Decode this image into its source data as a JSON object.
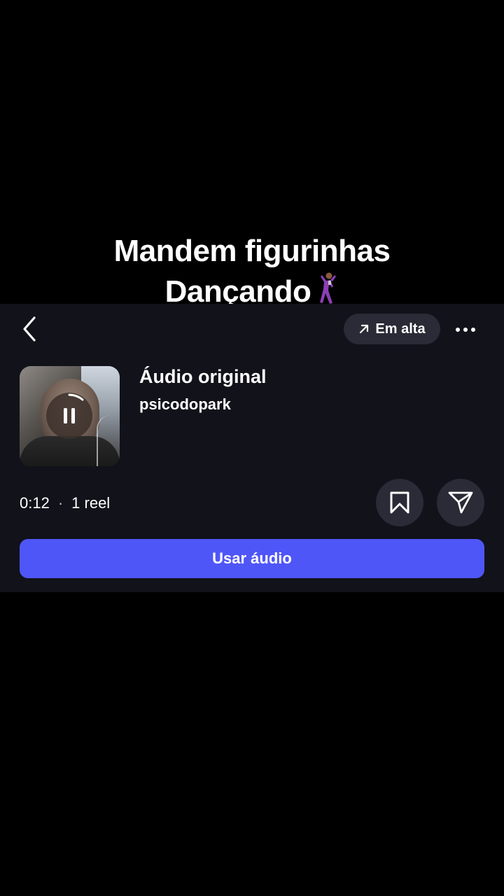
{
  "caption": {
    "line1": "Mandem figurinhas",
    "line2": "Dançando"
  },
  "header": {
    "trending_label": "Em alta"
  },
  "audio": {
    "title": "Áudio original",
    "artist": "psicodopark",
    "duration": "0:12",
    "separator": "·",
    "reel_count": "1 reel"
  },
  "actions": {
    "use_audio_label": "Usar áudio"
  },
  "icons": {
    "back": "chevron-left-icon",
    "trending": "arrow-up-right-icon",
    "more": "ellipsis-icon",
    "pause": "pause-icon",
    "save": "bookmark-icon",
    "share": "send-icon",
    "caption_emoji": "dancer-icon"
  },
  "colors": {
    "sheet_bg": "#12121a",
    "pill_bg": "#2a2b36",
    "accent": "#4f56f7"
  }
}
